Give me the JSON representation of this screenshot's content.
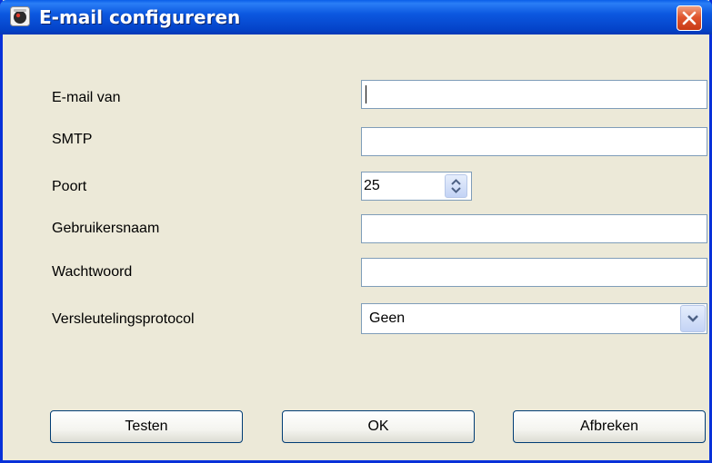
{
  "window": {
    "title": "E-mail configureren",
    "accent_color": "#0443c9",
    "close_icon": "close-icon"
  },
  "form": {
    "fields": [
      {
        "label": "E-mail van",
        "value": ""
      },
      {
        "label": "SMTP",
        "value": ""
      },
      {
        "label": "Poort",
        "value": "25"
      },
      {
        "label": "Gebruikersnaam",
        "value": ""
      },
      {
        "label": "Wachtwoord",
        "value": ""
      },
      {
        "label": "Versleutelingsprotocol",
        "value": "Geen"
      }
    ]
  },
  "buttons": {
    "test": "Testen",
    "ok": "OK",
    "cancel": "Afbreken"
  }
}
